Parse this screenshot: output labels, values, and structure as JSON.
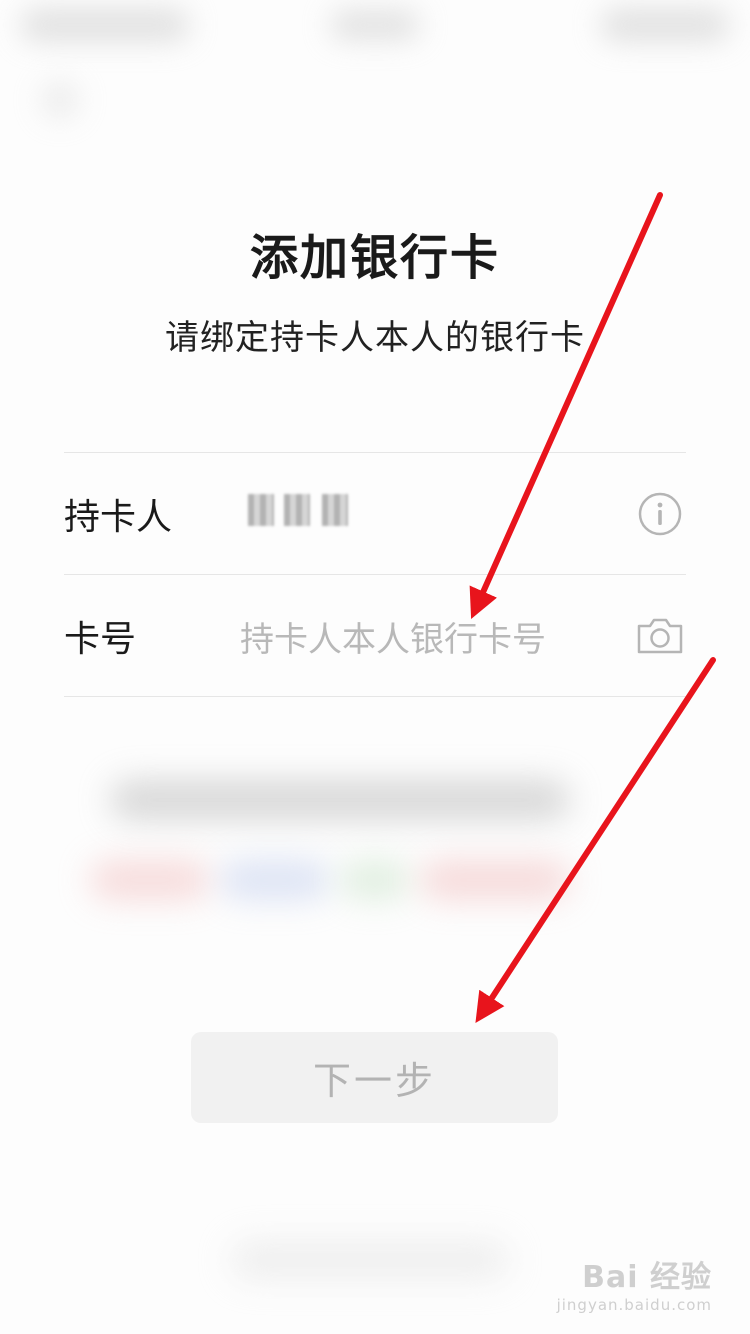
{
  "page": {
    "title": "添加银行卡",
    "subtitle": "请绑定持卡人本人的银行卡"
  },
  "form": {
    "holder": {
      "label": "持卡人",
      "value_masked": true,
      "info_icon": "info-circle-icon"
    },
    "card_number": {
      "label": "卡号",
      "placeholder": "持卡人本人银行卡号",
      "value": "",
      "camera_icon": "camera-icon"
    }
  },
  "actions": {
    "next_label": "下一步",
    "next_enabled": false
  },
  "annotations": {
    "arrow_color": "#e8141c"
  },
  "watermark": {
    "main": "Bai 经验",
    "sub": "jingyan.baidu.com"
  },
  "colors": {
    "text_primary": "#1a1a1a",
    "placeholder": "#b8b8b8",
    "divider": "#e6e6e6",
    "button_disabled_bg": "#f1f1f1",
    "button_disabled_text": "#b3b3b3"
  }
}
